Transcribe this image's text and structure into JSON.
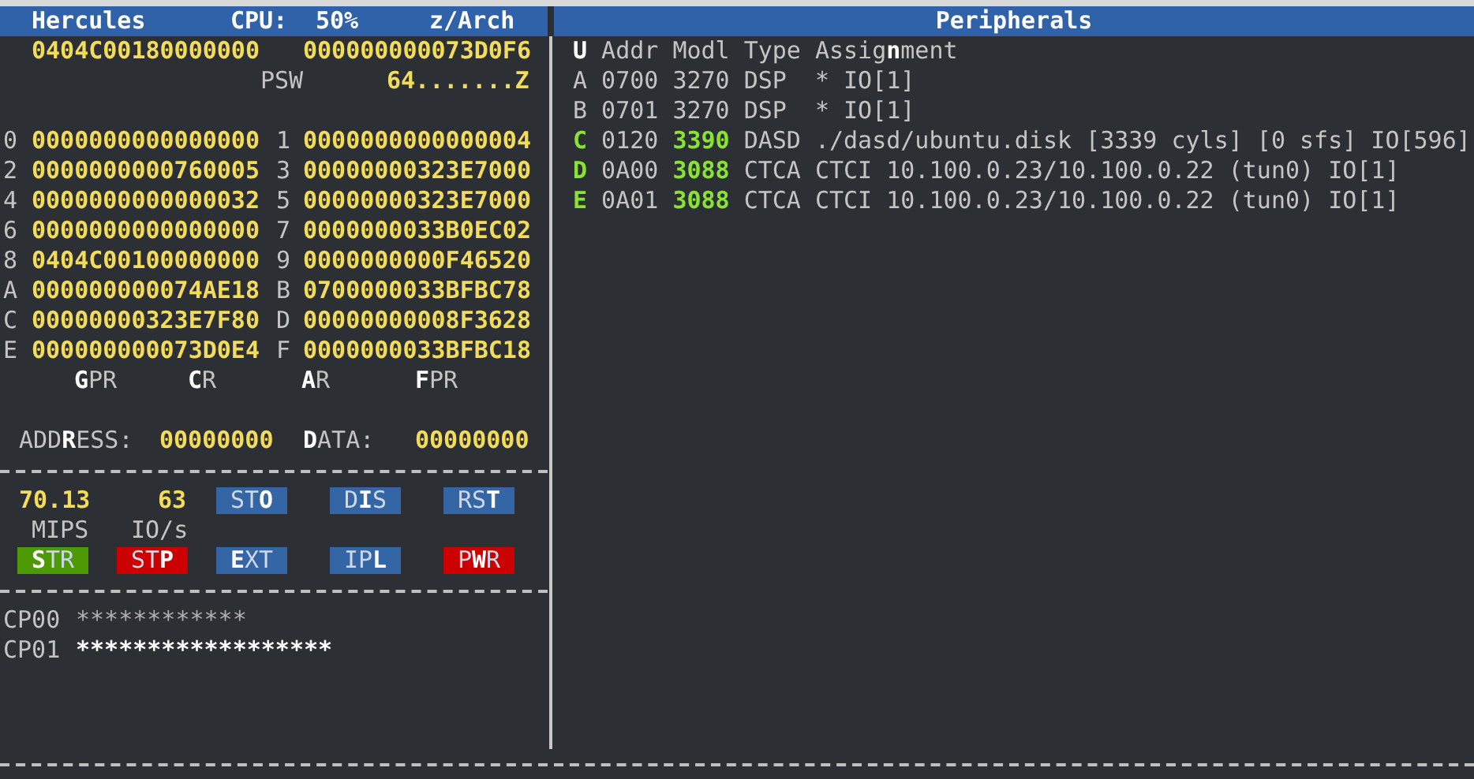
{
  "header": {
    "title": "Hercules",
    "cpu_label": "CPU:",
    "cpu_value": "50%",
    "arch": "z/Arch"
  },
  "psw": {
    "words": [
      "0404C00180000000",
      "000000000073D0F6"
    ],
    "label": "PSW",
    "flags": "64.......Z"
  },
  "registers": [
    {
      "label": "0",
      "value": "0000000000000000"
    },
    {
      "label": "1",
      "value": "0000000000000004"
    },
    {
      "label": "2",
      "value": "0000000000760005"
    },
    {
      "label": "3",
      "value": "00000000323E7000"
    },
    {
      "label": "4",
      "value": "0000000000000032"
    },
    {
      "label": "5",
      "value": "00000000323E7000"
    },
    {
      "label": "6",
      "value": "0000000000000000"
    },
    {
      "label": "7",
      "value": "0000000033B0EC02"
    },
    {
      "label": "8",
      "value": "0404C00100000000"
    },
    {
      "label": "9",
      "value": "0000000000F46520"
    },
    {
      "label": "A",
      "value": "000000000074AE18"
    },
    {
      "label": "B",
      "value": "0700000033BFBC78"
    },
    {
      "label": "C",
      "value": "00000000323E7F80"
    },
    {
      "label": "D",
      "value": "00000000008F3628"
    },
    {
      "label": "E",
      "value": "000000000073D0E4"
    },
    {
      "label": "F",
      "value": "0000000033BFBC18"
    }
  ],
  "register_tabs": [
    "**G**PR",
    "**C**R",
    "**A**R",
    "**F**PR"
  ],
  "address": {
    "label": "ADD**R**ESS:",
    "value": "00000000"
  },
  "data": {
    "label": "**D**ATA:",
    "value": "00000000"
  },
  "mips": {
    "value": "70.13",
    "label": "MIPS"
  },
  "io": {
    "value": "63",
    "label": "IO/s"
  },
  "buttons_row_1": [
    {
      "label": "ST**O**",
      "color": "#3465a4"
    },
    {
      "label": "D**I**S",
      "color": "#3465a4"
    },
    {
      "label": "RS**T**",
      "color": "#3465a4"
    }
  ],
  "buttons_row_2": [
    {
      "label": "**S**TR",
      "color": "#4e9a06"
    },
    {
      "label": "ST**P**",
      "color": "#cc0000"
    },
    {
      "label": "**E**XT",
      "color": "#3465a4"
    },
    {
      "label": "IP**L**",
      "color": "#3465a4"
    },
    {
      "label": "P**W**R",
      "color": "#cc0000"
    }
  ],
  "cpus": [
    {
      "label": "CP00",
      "meter": "************",
      "active": false
    },
    {
      "label": "CP01",
      "meter": "******************",
      "active": true
    }
  ],
  "peripherals": {
    "title": "Peripherals",
    "unit_header": "U",
    "columns": [
      "Addr",
      "Modl",
      "Type",
      "Assig**n**ment"
    ],
    "devices": [
      {
        "letter": "A",
        "addr": "0700",
        "model": "3270",
        "type": "DSP",
        "assignment": "* IO[1]",
        "online": false
      },
      {
        "letter": "B",
        "addr": "0701",
        "model": "3270",
        "type": "DSP",
        "assignment": "* IO[1]",
        "online": false
      },
      {
        "letter": "C",
        "addr": "0120",
        "model": "3390",
        "type": "DASD",
        "assignment": "./dasd/ubuntu.disk [3339 cyls] [0 sfs] IO[596]",
        "online": true
      },
      {
        "letter": "D",
        "addr": "0A00",
        "model": "3088",
        "type": "CTCA",
        "assignment": "CTCI 10.100.0.23/10.100.0.22 (tun0) IO[1]",
        "online": true
      },
      {
        "letter": "E",
        "addr": "0A01",
        "model": "3088",
        "type": "CTCA",
        "assignment": "CTCI 10.100.0.23/10.100.0.22 (tun0) IO[1]",
        "online": true
      }
    ]
  }
}
